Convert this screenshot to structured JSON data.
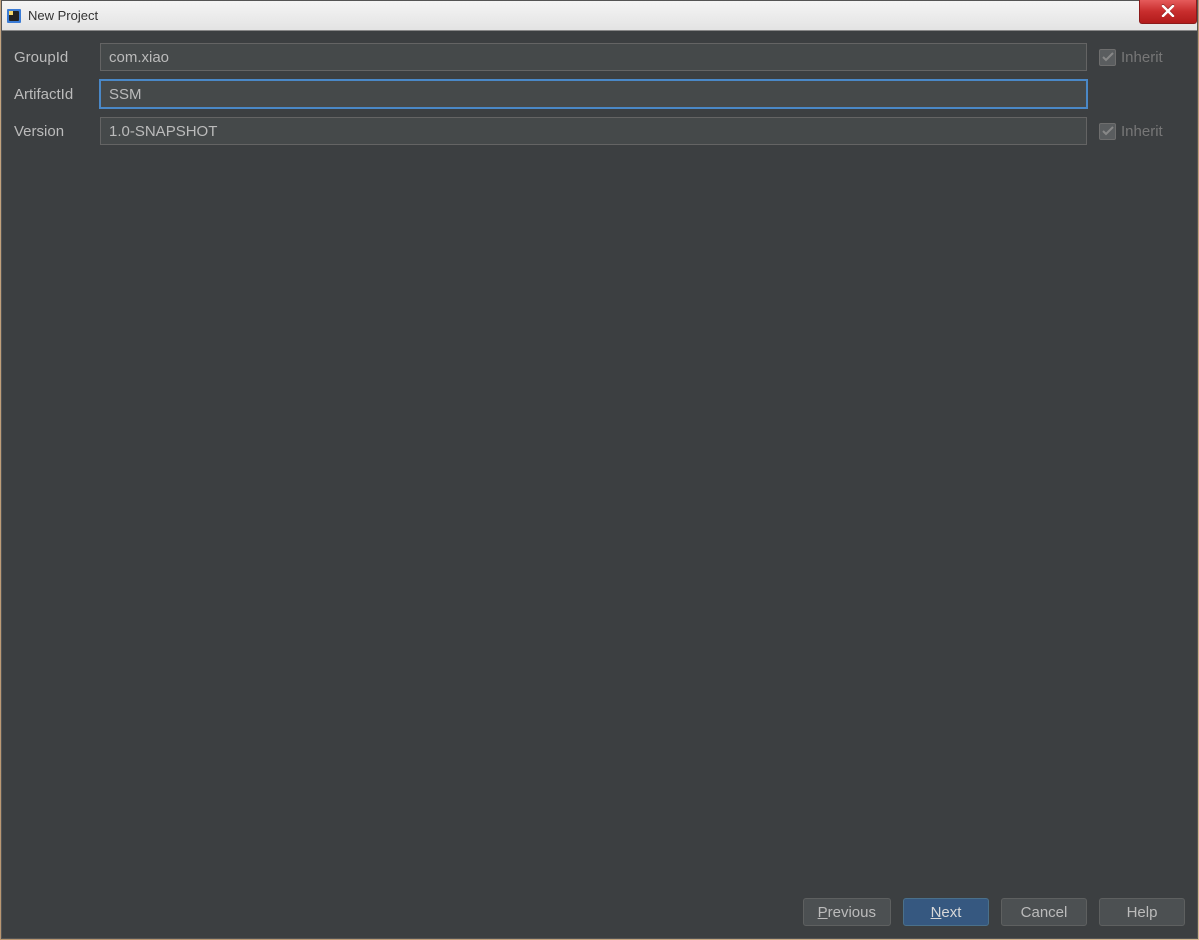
{
  "titlebar": {
    "title": "New Project"
  },
  "form": {
    "groupId": {
      "label": "GroupId",
      "value": "com.xiao",
      "inherit": "Inherit"
    },
    "artifactId": {
      "label": "ArtifactId",
      "value": "SSM"
    },
    "version": {
      "label": "Version",
      "value": "1.0-SNAPSHOT",
      "inherit": "Inherit"
    }
  },
  "buttons": {
    "previous_prefix": "P",
    "previous_rest": "revious",
    "next_prefix": "N",
    "next_rest": "ext",
    "cancel": "Cancel",
    "help": "Help"
  }
}
